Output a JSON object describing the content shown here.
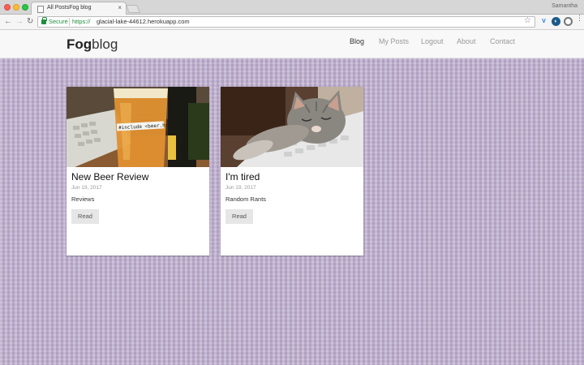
{
  "browser": {
    "tab_title": "All PostsFog blog",
    "tab_close": "×",
    "profile_name": "Samantha",
    "secure_label": "Secure",
    "url_scheme": "https://",
    "url_host": "glacial-lake-44612.herokuapp.com",
    "icons": {
      "back": "back-arrow-icon",
      "forward": "forward-arrow-icon",
      "reload": "reload-icon",
      "lock": "lock-icon",
      "star": "star-icon",
      "menu": "menu-dots-icon"
    }
  },
  "site": {
    "brand_bold": "Fog",
    "brand_light": "blog",
    "nav": [
      {
        "label": "Blog",
        "active": true
      },
      {
        "label": "My Posts",
        "active": false
      },
      {
        "label": "Logout",
        "active": false
      },
      {
        "label": "About",
        "active": false
      },
      {
        "label": "Contact",
        "active": false
      }
    ],
    "posts": [
      {
        "title": "New Beer Review",
        "date": "Jun 19, 2017",
        "category": "Reviews",
        "button": "Read",
        "image": "beer-glass-photo",
        "image_label": "#include <beer.h>"
      },
      {
        "title": "I'm tired",
        "date": "Jun 19, 2017",
        "category": "Random Rants",
        "button": "Read",
        "image": "sleeping-kitten-photo"
      }
    ]
  },
  "colors": {
    "secure_green": "#1e8e3e",
    "background_purple": "#bfb0cf",
    "nav_background": "#f8f8f8",
    "button_grey": "#e6e6e6"
  }
}
